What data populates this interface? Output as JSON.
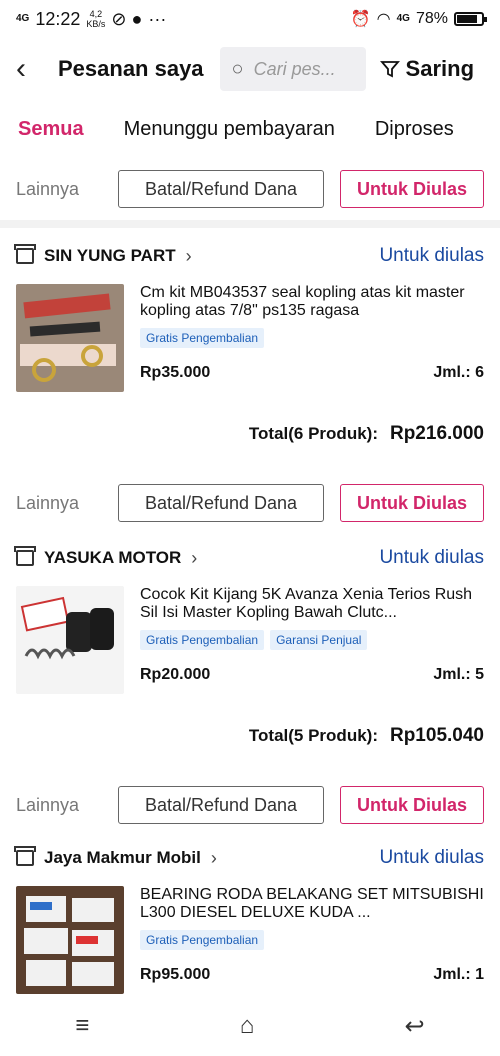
{
  "status_bar": {
    "network": "4G",
    "time": "12:22",
    "speed_value": "4,2",
    "speed_unit": "KB/s",
    "extra": "···",
    "net_right": "4G",
    "battery": "78%"
  },
  "header": {
    "back": "‹",
    "title": "Pesanan saya",
    "search_placeholder": "Cari pes...",
    "filter_label": "Saring"
  },
  "tabs": [
    "Semua",
    "Menunggu pembayaran",
    "Diproses"
  ],
  "actions": {
    "more": "Lainnya",
    "refund": "Batal/Refund Dana",
    "review": "Untuk Diulas"
  },
  "orders": [
    {
      "shop": "SIN YUNG PART",
      "status": "Untuk diulas",
      "product": "Cm kit MB043537 seal kopling atas kit master kopling atas 7/8\" ps135 ragasa",
      "badges": [
        "Gratis Pengembalian"
      ],
      "price": "Rp35.000",
      "qty": "Jml.: 6",
      "total_label": "Total(6 Produk):",
      "total": "Rp216.000"
    },
    {
      "shop": "YASUKA MOTOR",
      "status": "Untuk diulas",
      "product": "Cocok Kit Kijang 5K Avanza Xenia Terios Rush Sil Isi Master Kopling Bawah Clutc...",
      "badges": [
        "Gratis Pengembalian",
        "Garansi Penjual"
      ],
      "price": "Rp20.000",
      "qty": "Jml.: 5",
      "total_label": "Total(5 Produk):",
      "total": "Rp105.040"
    },
    {
      "shop": "Jaya Makmur Mobil",
      "status": "Untuk diulas",
      "product": "BEARING RODA BELAKANG SET MITSUBISHI L300 DIESEL DELUXE KUDA ...",
      "badges": [
        "Gratis Pengembalian"
      ],
      "price": "Rp95.000",
      "qty": "Jml.: 1"
    }
  ],
  "nav": {
    "menu": "≡",
    "home": "⌂",
    "back": "↩"
  },
  "colors": {
    "accent": "#d2266a",
    "link": "#1b4aa0",
    "badge_bg": "#e6f0fb"
  }
}
